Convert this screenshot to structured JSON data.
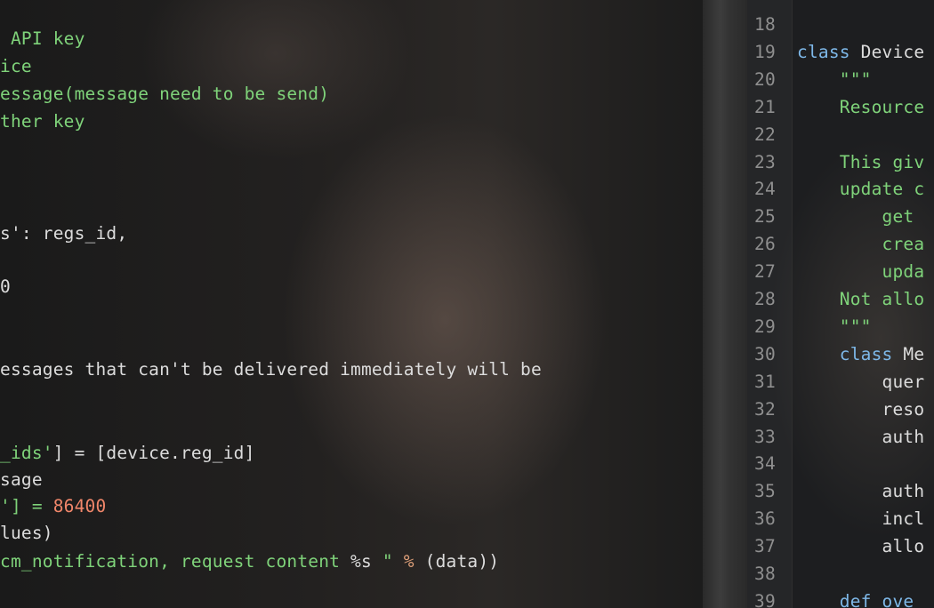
{
  "left": {
    "lines": [
      {
        "segments": [
          {
            "text": " API key",
            "color": "str"
          }
        ]
      },
      {
        "segments": [
          {
            "text": "ice",
            "color": "str"
          }
        ]
      },
      {
        "segments": [
          {
            "text": "essage(message need to be send)",
            "color": "str"
          }
        ]
      },
      {
        "segments": [
          {
            "text": "ther key",
            "color": "str"
          }
        ]
      },
      {
        "segments": [
          {
            "text": "s': regs_id,",
            "color": "pl"
          }
        ]
      },
      {
        "segments": [
          {
            "text": "0",
            "color": "pl"
          }
        ]
      },
      {
        "segments": [
          {
            "text": "essages that can't be delivered immediately will be",
            "color": "pl"
          }
        ]
      },
      {
        "segments": [
          {
            "text": "_ids'",
            "color": "str"
          },
          {
            "text": "] = [device.reg_id]",
            "color": "pl"
          }
        ]
      },
      {
        "segments": [
          {
            "text": "sage",
            "color": "pl"
          }
        ]
      },
      {
        "segments": [
          {
            "text": "'] = ",
            "color": "str"
          },
          {
            "text": "86400",
            "color": "num"
          }
        ]
      },
      {
        "segments": [
          {
            "text": "lues)",
            "color": "pl"
          }
        ]
      },
      {
        "segments": [
          {
            "text": "cm_notification, request content ",
            "color": "str"
          },
          {
            "text": "%s",
            "color": "pl"
          },
          {
            "text": " \" ",
            "color": "str"
          },
          {
            "text": "%",
            "color": "op"
          },
          {
            "text": " (data))",
            "color": "pl"
          }
        ]
      }
    ]
  },
  "right": {
    "lines": [
      {
        "num": "18",
        "segments": []
      },
      {
        "num": "19",
        "segments": [
          {
            "text": "class ",
            "color": "kw"
          },
          {
            "text": "Device",
            "color": "pl"
          }
        ]
      },
      {
        "num": "20",
        "segments": [
          {
            "text": "    \"\"\"",
            "color": "str"
          }
        ]
      },
      {
        "num": "21",
        "segments": [
          {
            "text": "    Resource",
            "color": "str"
          }
        ]
      },
      {
        "num": "22",
        "segments": []
      },
      {
        "num": "23",
        "segments": [
          {
            "text": "    This giv",
            "color": "str"
          }
        ]
      },
      {
        "num": "24",
        "segments": [
          {
            "text": "    update c",
            "color": "str"
          }
        ]
      },
      {
        "num": "25",
        "segments": [
          {
            "text": "        get",
            "color": "str"
          }
        ]
      },
      {
        "num": "26",
        "segments": [
          {
            "text": "        crea",
            "color": "str"
          }
        ]
      },
      {
        "num": "27",
        "segments": [
          {
            "text": "        upda",
            "color": "str"
          }
        ]
      },
      {
        "num": "28",
        "segments": [
          {
            "text": "    Not allo",
            "color": "str"
          }
        ]
      },
      {
        "num": "29",
        "segments": [
          {
            "text": "    \"\"\"",
            "color": "str"
          }
        ]
      },
      {
        "num": "30",
        "segments": [
          {
            "text": "    class ",
            "color": "kw"
          },
          {
            "text": "Me",
            "color": "pl"
          }
        ]
      },
      {
        "num": "31",
        "segments": [
          {
            "text": "        quer",
            "color": "pl"
          }
        ]
      },
      {
        "num": "32",
        "segments": [
          {
            "text": "        reso",
            "color": "pl"
          }
        ]
      },
      {
        "num": "33",
        "segments": [
          {
            "text": "        auth",
            "color": "pl"
          }
        ]
      },
      {
        "num": "34",
        "segments": []
      },
      {
        "num": "35",
        "segments": [
          {
            "text": "        auth",
            "color": "pl"
          }
        ]
      },
      {
        "num": "36",
        "segments": [
          {
            "text": "        incl",
            "color": "pl"
          }
        ]
      },
      {
        "num": "37",
        "segments": [
          {
            "text": "        allo",
            "color": "pl"
          }
        ]
      },
      {
        "num": "38",
        "segments": []
      },
      {
        "num": "39",
        "segments": [
          {
            "text": "    def ove",
            "color": "kw"
          }
        ]
      }
    ]
  }
}
